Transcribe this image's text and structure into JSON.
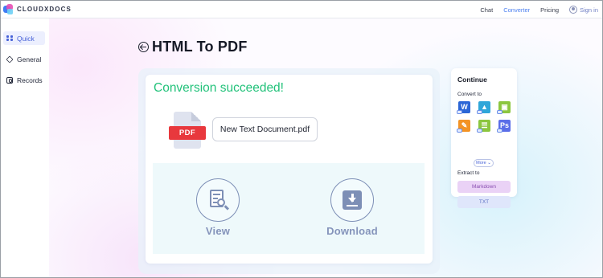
{
  "header": {
    "logo_text": "CLOUDXDOCS",
    "nav": [
      "Chat",
      "Converter",
      "Pricing"
    ],
    "active_nav": "Converter",
    "sign_in": "Sign in"
  },
  "sidebar": {
    "items": [
      {
        "label": "Quick",
        "icon": "grid-icon",
        "active": true
      },
      {
        "label": "General",
        "icon": "shapes-icon",
        "active": false
      },
      {
        "label": "Records",
        "icon": "records-icon",
        "active": false
      }
    ]
  },
  "main": {
    "title": "HTML To PDF",
    "status": "Conversion succeeded!",
    "file_badge": "PDF",
    "file_name": "New Text Document.pdf",
    "actions": [
      "View",
      "Download"
    ]
  },
  "continue_panel": {
    "title": "Continue",
    "convert_to_label": "Convert to",
    "targets": [
      {
        "icon": "word-icon",
        "glyph": "W",
        "color": "#2b66d6"
      },
      {
        "icon": "image-icon",
        "glyph": "",
        "color": "#2fa6d9"
      },
      {
        "icon": "picture-icon",
        "glyph": "",
        "color": "#8cc63f"
      },
      {
        "icon": "annotate-icon",
        "glyph": "",
        "color": "#f39325"
      },
      {
        "icon": "table-icon",
        "glyph": "",
        "color": "#8cc63f"
      },
      {
        "icon": "photoshop-icon",
        "glyph": "Ps",
        "color": "#5b6ee8"
      }
    ],
    "more_label": "More",
    "extract_to_label": "Extract to",
    "extract_options": [
      "Markdown",
      "TXT"
    ]
  }
}
